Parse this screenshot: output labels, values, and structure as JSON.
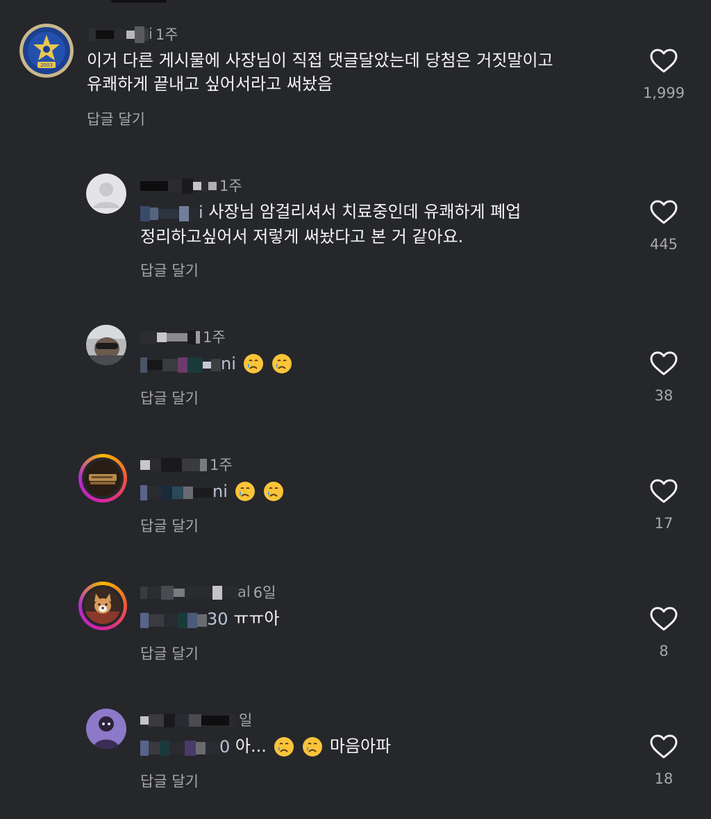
{
  "comments": [
    {
      "time": "1주",
      "text_lines": [
        "이거 다른 게시물에 사장님이 직접 댓글달았는데 당첨은 거짓말이고",
        "유쾌하게 끝내고 싶어서라고 써놨음"
      ],
      "reply_label": "답글 달기",
      "likes": "1,999",
      "avatar_icon": "club-emblem-avatar"
    },
    {
      "time": "1주",
      "mention_suffix": "i",
      "text_after_mention": "사장님 암걸리셔서 치료중인데 유쾌하게 폐업",
      "text_line2": "정리하고싶어서 저렇게 써놨다고 본 거 같아요.",
      "reply_label": "답글 달기",
      "likes": "445",
      "avatar_icon": "default-user-avatar"
    },
    {
      "time": "1주",
      "mention_suffix": "ni",
      "reply_label": "답글 달기",
      "likes": "38",
      "avatar_icon": "car-selfie-avatar"
    },
    {
      "time": "1주",
      "mention_suffix": "ni",
      "reply_label": "답글 달기",
      "likes": "17",
      "avatar_icon": "object-photo-avatar"
    },
    {
      "time": "6일",
      "mention_suffix": "30",
      "text_after_mention": "ㅠㅠ아",
      "reply_label": "답글 달기",
      "likes": "8",
      "avatar_icon": "corgi-avatar"
    },
    {
      "time": "일",
      "mention_suffix": "0",
      "text_before_emoji": "아...",
      "text_after_emoji": "마음아파",
      "reply_label": "답글 달기",
      "likes": "18",
      "avatar_icon": "character-avatar"
    }
  ],
  "colors": {
    "background": "#26272b",
    "text_primary": "#f4f4f4",
    "text_secondary": "#a7a8ad",
    "emoji_face": "#f9c43a",
    "emoji_tear": "#3aa0f0"
  },
  "icons": [
    "heart-outline-icon",
    "crying-face-emoji"
  ]
}
